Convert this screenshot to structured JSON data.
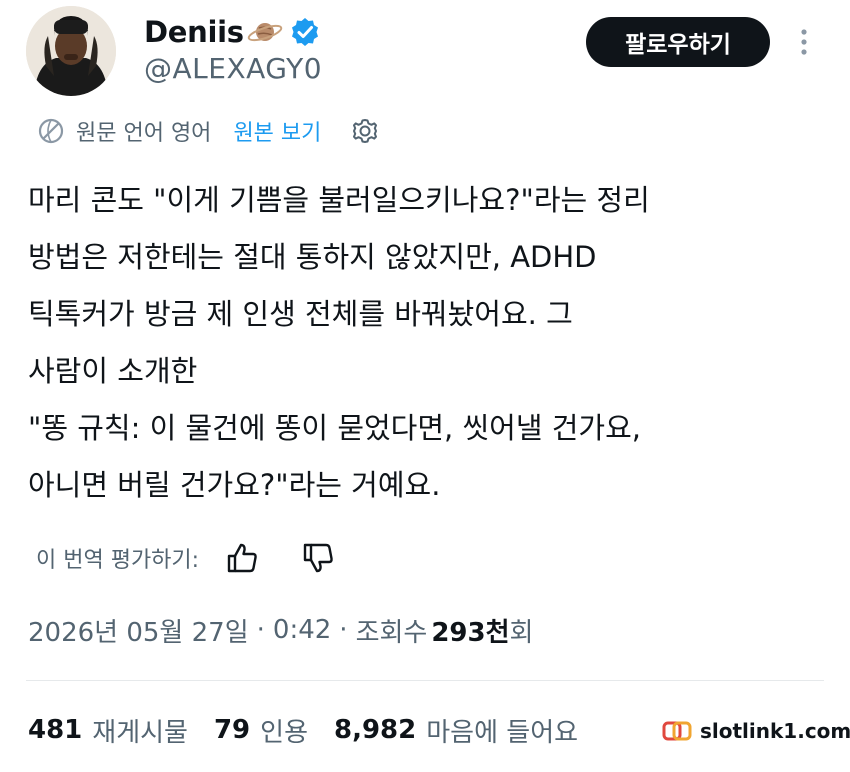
{
  "user": {
    "display_name": "Deniis",
    "handle": "@ALEXAGY0",
    "follow_label": "팔로우하기"
  },
  "translation": {
    "notice": "원문 언어 영어",
    "view_original": "원본 보기"
  },
  "tweet": {
    "lines": [
      "마리 콘도 \"이게 기쁨을 불러일으키나요?\"라는 정리",
      "방법은 저한테는 절대 통하지 않았지만, ADHD",
      "틱톡커가 방금 제 인생 전체를 바꿔놨어요. 그",
      "사람이 소개한",
      "\"똥 규칙: 이 물건에 똥이 묻었다면, 씻어낼 건가요,",
      "아니면 버릴 건가요?\"라는 거예요."
    ]
  },
  "rate": {
    "label": "이 번역 평가하기:"
  },
  "meta": {
    "date": "2026년 05월 27일",
    "separator": "·",
    "time": "0:42",
    "views_label": "조회수",
    "views_count": "293천",
    "views_suffix": "회"
  },
  "stats": {
    "retweets_count": "481",
    "retweets_label": "재게시물",
    "quotes_count": "79",
    "quotes_label": "인용",
    "likes_count": "8,982",
    "likes_label": "마음에 들어요"
  },
  "watermark": {
    "text": "slotlink1.com"
  },
  "colors": {
    "accent": "#1d9bf0",
    "text": "#0f1419",
    "secondary": "#536471",
    "button_bg": "#0f1419"
  },
  "icons": {
    "planet": "planet-icon",
    "verified": "verified-badge-icon",
    "more": "more-vertical-icon",
    "globe": "globe-translate-icon",
    "settings": "gear-icon",
    "thumb_up": "thumbs-up-icon",
    "thumb_down": "thumbs-down-icon"
  }
}
